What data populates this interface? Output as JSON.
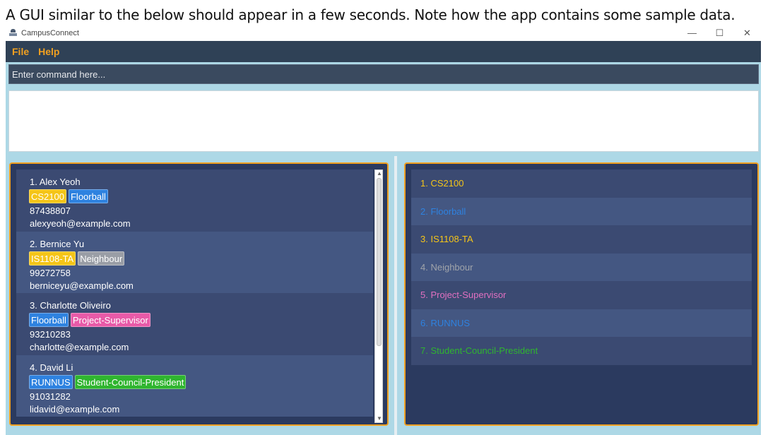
{
  "caption": "A GUI similar to the below should appear in a few seconds. Note how the app contains some sample data.",
  "window": {
    "title": "CampusConnect",
    "controls": {
      "minimize": "—",
      "maximize": "☐",
      "close": "✕"
    }
  },
  "menu": {
    "file": "File",
    "help": "Help"
  },
  "command": {
    "placeholder": "Enter command here..."
  },
  "result": {
    "text": ""
  },
  "colors": {
    "accent": "#f0a020",
    "panel_bg": "#2b3a5f",
    "row_odd": "#3b4a72",
    "row_even": "#445782"
  },
  "persons": [
    {
      "name": "1. Alex Yeoh",
      "tags": [
        {
          "label": "CS2100",
          "color": "#f5c518"
        },
        {
          "label": "Floorball",
          "color": "#2e82e0"
        }
      ],
      "phone": "87438807",
      "email": "alexyeoh@example.com"
    },
    {
      "name": "2. Bernice Yu",
      "tags": [
        {
          "label": "IS1108-TA",
          "color": "#f5c518"
        },
        {
          "label": "Neighbour",
          "color": "#9a9ea6"
        }
      ],
      "phone": "99272758",
      "email": "berniceyu@example.com"
    },
    {
      "name": "3. Charlotte Oliveiro",
      "tags": [
        {
          "label": "Floorball",
          "color": "#2e82e0"
        },
        {
          "label": "Project-Supervisor",
          "color": "#e85aa8"
        }
      ],
      "phone": "93210283",
      "email": "charlotte@example.com"
    },
    {
      "name": "4. David Li",
      "tags": [
        {
          "label": "RUNNUS",
          "color": "#2e82e0"
        },
        {
          "label": "Student-Council-President",
          "color": "#2fb52f"
        }
      ],
      "phone": "91031282",
      "email": "lidavid@example.com"
    }
  ],
  "tag_list": [
    {
      "label": "1. CS2100",
      "color": "#f5c518"
    },
    {
      "label": "2. Floorball",
      "color": "#2e82e0"
    },
    {
      "label": "3. IS1108-TA",
      "color": "#f5c518"
    },
    {
      "label": "4. Neighbour",
      "color": "#a0a4aa"
    },
    {
      "label": "5. Project-Supervisor",
      "color": "#e070c0"
    },
    {
      "label": "6. RUNNUS",
      "color": "#2e82e0"
    },
    {
      "label": "7. Student-Council-President",
      "color": "#2fb52f"
    }
  ]
}
